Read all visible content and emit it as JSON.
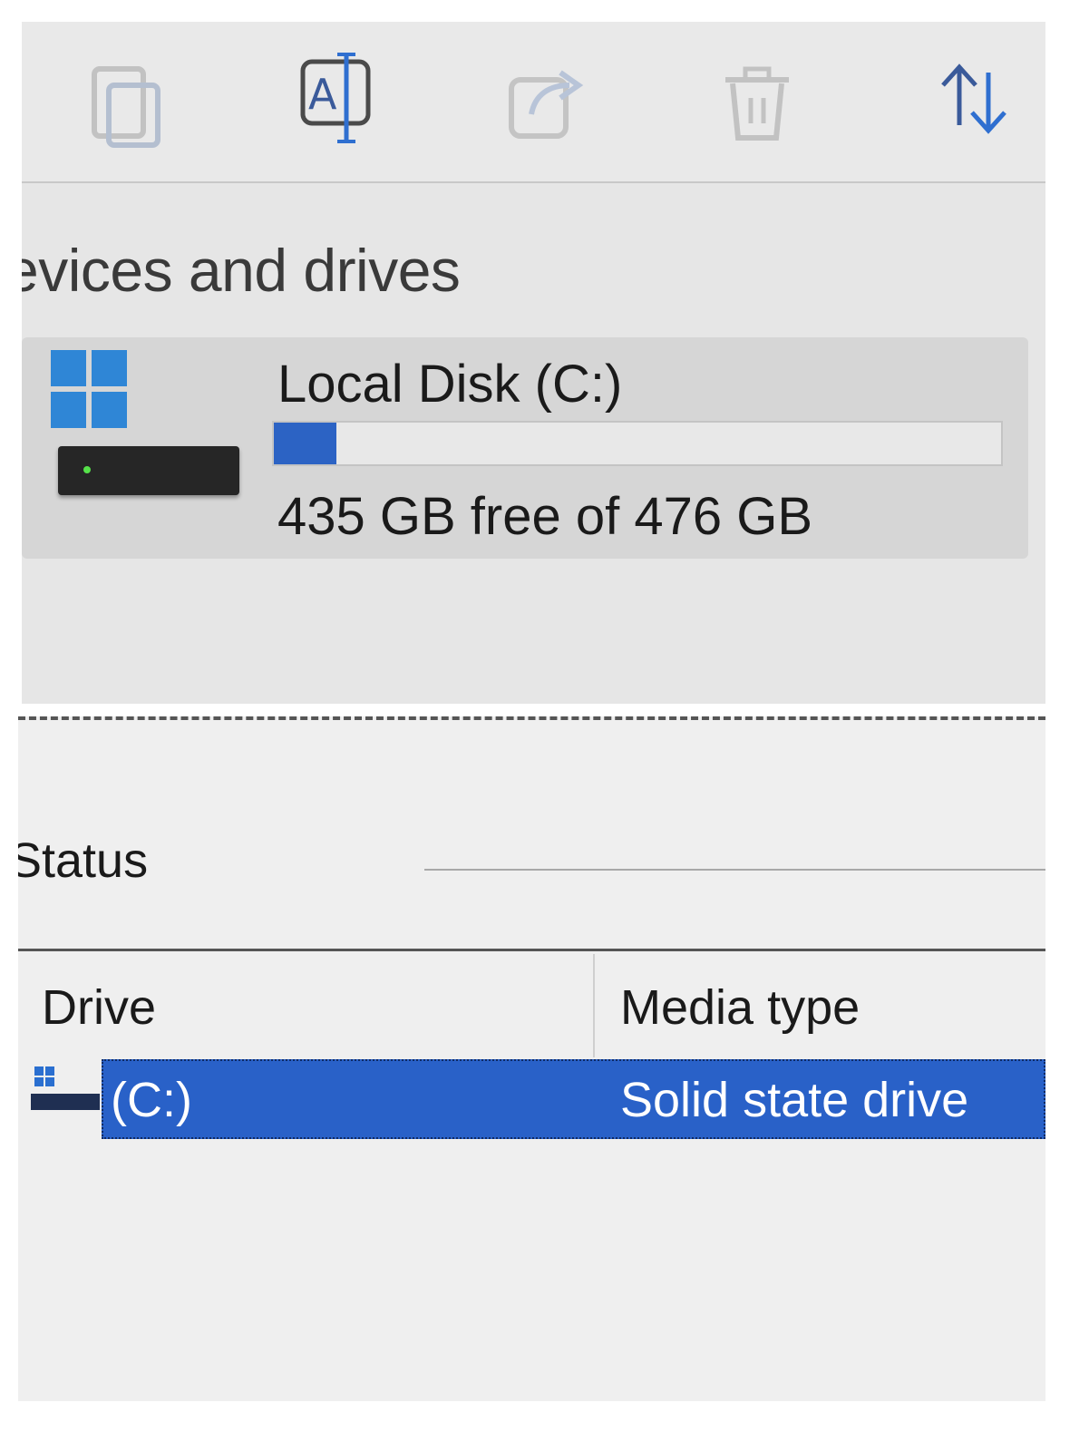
{
  "explorer": {
    "toolbar": {
      "buttons": [
        {
          "name": "copy",
          "icon": "copy-icon"
        },
        {
          "name": "rename",
          "icon": "rename-icon"
        },
        {
          "name": "share",
          "icon": "share-icon"
        },
        {
          "name": "delete",
          "icon": "trash-icon"
        },
        {
          "name": "sort",
          "icon": "sort-icon"
        }
      ]
    },
    "section_title": "evices and drives",
    "drive": {
      "name": "Local Disk (C:)",
      "space": "435 GB free of 476 GB",
      "used_fraction": 0.086,
      "icon": "windows-logo-icon"
    }
  },
  "optimize": {
    "status_label": "Status",
    "columns": {
      "drive": "Drive",
      "media_type": "Media type"
    },
    "rows": [
      {
        "drive": "(C:)",
        "media_type": "Solid state drive",
        "selected": true,
        "icon": "drive-icon"
      }
    ]
  },
  "colors": {
    "accent": "#2961c8",
    "windows_blue": "#2f86d6"
  }
}
